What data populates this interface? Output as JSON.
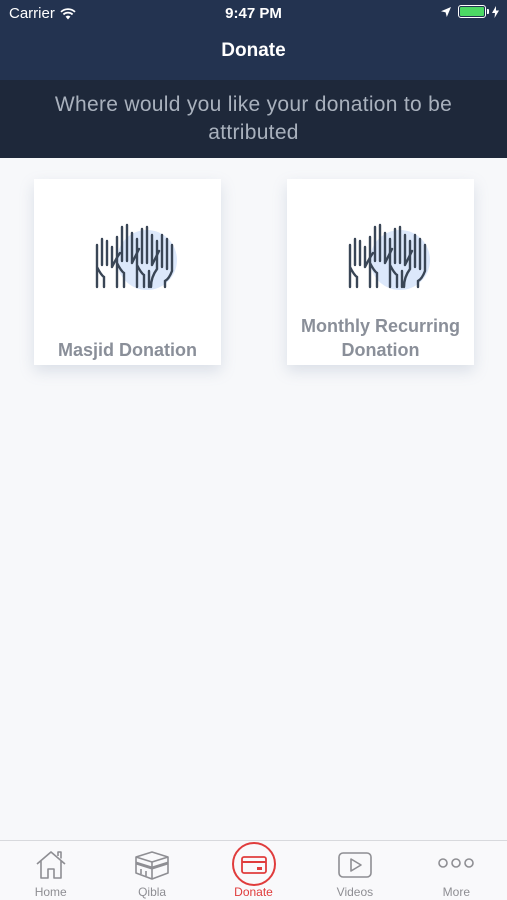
{
  "status_bar": {
    "carrier": "Carrier",
    "time": "9:47 PM"
  },
  "nav": {
    "title": "Donate"
  },
  "subheader": {
    "text": "Where would you like your donation to be attributed"
  },
  "cards": [
    {
      "label": "Masjid Donation",
      "icon": "raised-hands-icon"
    },
    {
      "label": "Monthly Recurring Donation",
      "icon": "raised-hands-icon"
    }
  ],
  "tabs": [
    {
      "label": "Home",
      "icon": "home-icon"
    },
    {
      "label": "Qibla",
      "icon": "kaaba-icon"
    },
    {
      "label": "Donate",
      "icon": "card-icon",
      "active": true
    },
    {
      "label": "Videos",
      "icon": "play-icon"
    },
    {
      "label": "More",
      "icon": "more-icon"
    }
  ],
  "colors": {
    "header": "#233350",
    "subheader": "#1e283a",
    "accent": "#e03c3c",
    "battery": "#4cd964"
  }
}
